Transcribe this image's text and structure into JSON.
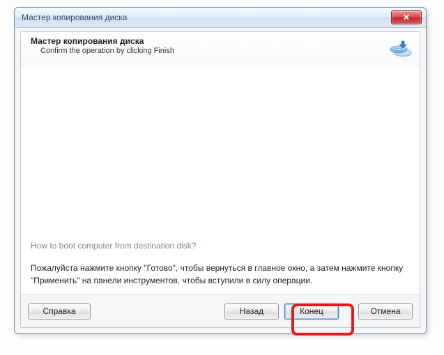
{
  "window": {
    "title": "Мастер копирования диска"
  },
  "header": {
    "title": "Мастер копирования диска",
    "subtitle": "Confirm the operation by clicking Finish",
    "icon": "disk-copy-icon"
  },
  "content": {
    "hint_link": "How to boot computer from destination disk?",
    "info_text": "Пожалуйста нажмите кнопку \"Готово\", чтобы вернуться в главное окно, а затем нажмите кнопку \"Применить\" на панели инструментов, чтобы вступили в силу операции."
  },
  "footer": {
    "help_label": "Справка",
    "back_label": "Назад",
    "finish_label": "Конец",
    "cancel_label": "Отмена"
  },
  "close_glyph": "✕"
}
